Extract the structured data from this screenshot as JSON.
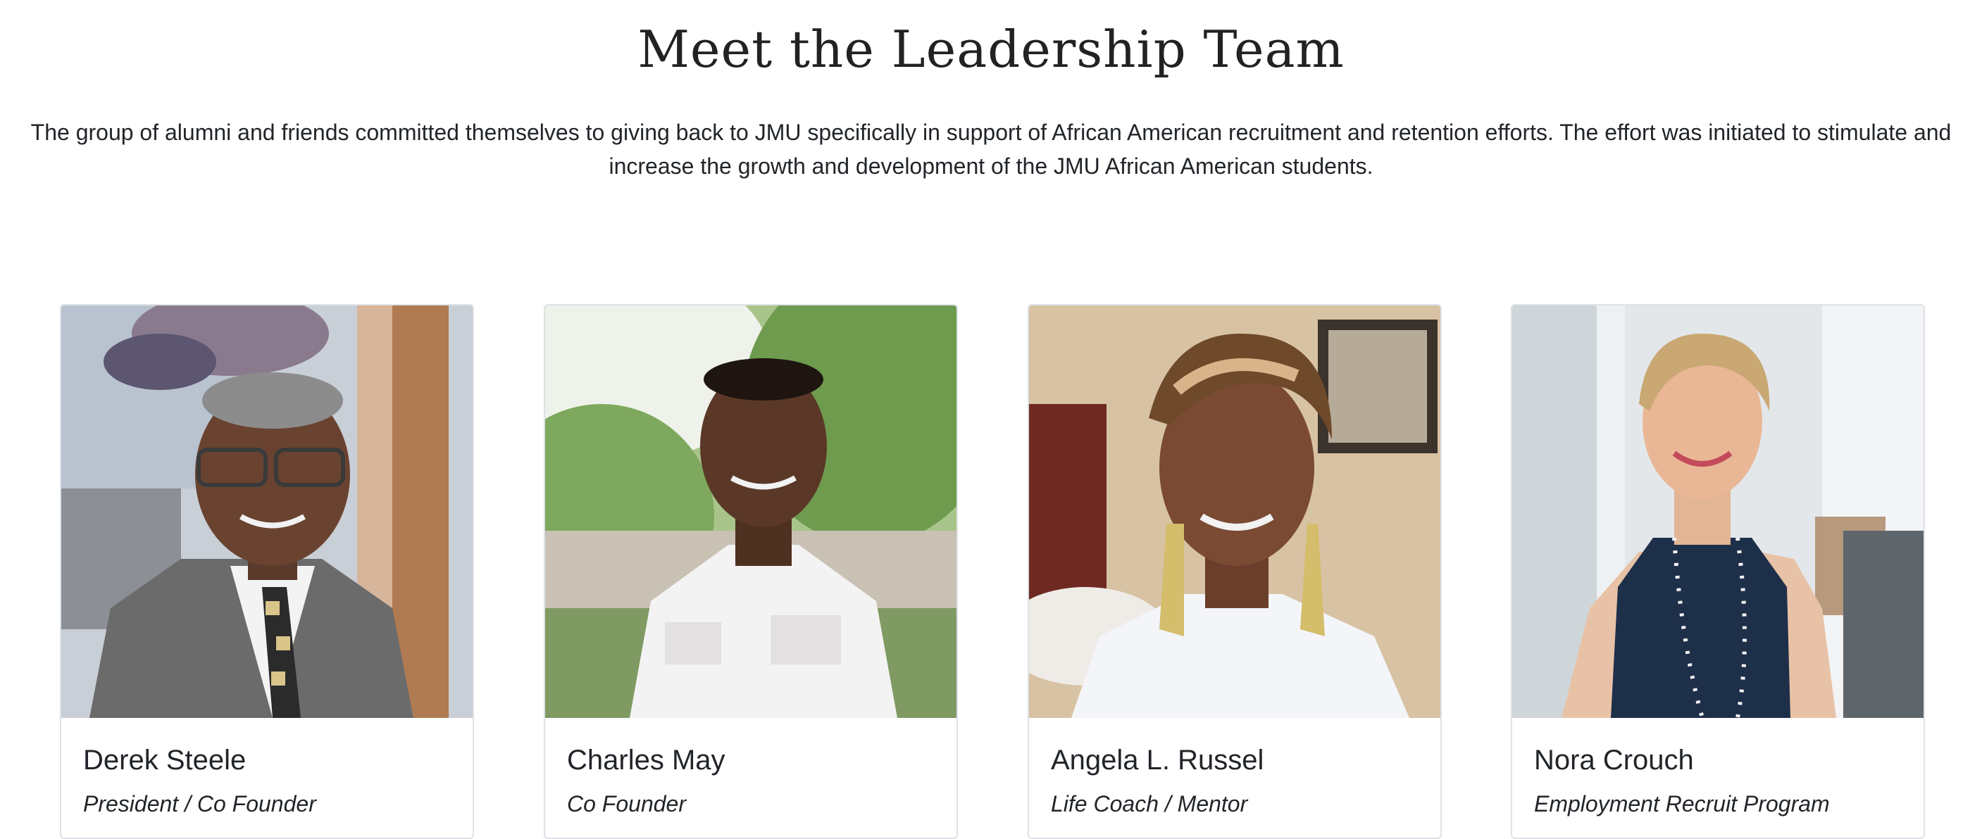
{
  "header": {
    "title": "Meet the Leadership Team",
    "intro": "The group of alumni and friends committed themselves to giving back to JMU specifically in support of African American recruitment and retention efforts. The effort was initiated to stimulate and increase the growth and development of the JMU African American students."
  },
  "team": [
    {
      "name": "Derek Steele",
      "role": "President / Co Founder"
    },
    {
      "name": "Charles May",
      "role": "Co Founder"
    },
    {
      "name": "Angela L. Russel",
      "role": "Life Coach / Mentor"
    },
    {
      "name": "Nora Crouch",
      "role": "Employment Recruit Program"
    }
  ],
  "colors": {
    "text": "#212529",
    "card_border": "#dee2e6"
  }
}
